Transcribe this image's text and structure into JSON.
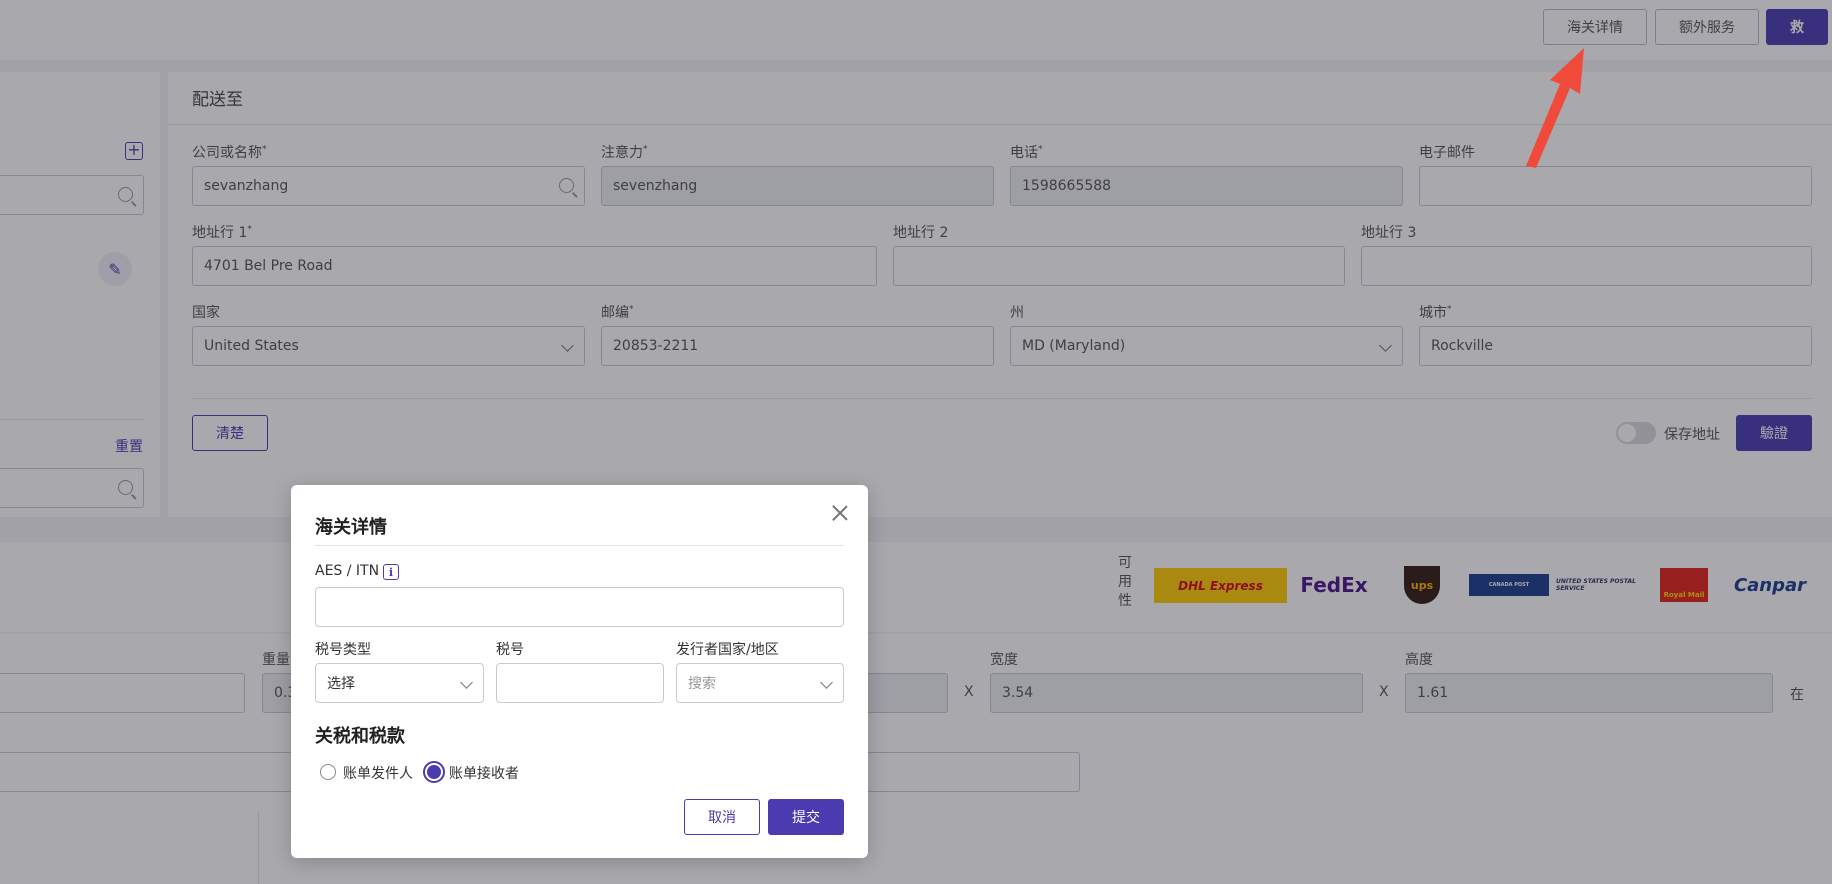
{
  "topbar": {
    "customs_label": "海关详情",
    "extra_services_label": "额外服务",
    "rescue_label": "救"
  },
  "ship_to": {
    "title": "配送至",
    "company_label": "公司或名称",
    "company_value": "sevanzhang",
    "attention_label": "注意力",
    "attention_value": "sevenzhang",
    "phone_label": "电话",
    "phone_value": "1598665588",
    "email_label": "电子邮件",
    "email_value": "",
    "address1_label": "地址行 1",
    "address1_value": "4701 Bel Pre Road",
    "address2_label": "地址行 2",
    "address2_value": "",
    "address3_label": "地址行 3",
    "address3_value": "",
    "country_label": "国家",
    "country_value": "United States",
    "zip_label": "邮编",
    "zip_value": "20853-2211",
    "state_label": "州",
    "state_value": "MD (Maryland)",
    "city_label": "城市",
    "city_value": "Rockville",
    "clear_label": "清楚",
    "save_address_label": "保存地址",
    "verify_label": "驗證",
    "required_mark": "*"
  },
  "left_panel": {
    "reset_label": "重置"
  },
  "availability": {
    "label_chars": [
      "可",
      "用",
      "性"
    ],
    "carriers": [
      "DHL Express",
      "FedEx",
      "ups",
      "CANADA POST",
      "UNITED STATES POSTAL SERVICE",
      "Royal Mail",
      "Canpar"
    ]
  },
  "dimensions": {
    "weight_label": "重量",
    "weight_value": "0.3",
    "width_label": "宽度",
    "width_value": "3.54",
    "height_label": "高度",
    "height_value": "1.61",
    "x_symbol": "X",
    "unit_label": "在"
  },
  "modal": {
    "title": "海关详情",
    "aes_label": "AES / ITN",
    "aes_value": "",
    "tax_type_label": "税号类型",
    "tax_type_value": "选择",
    "tax_no_label": "税号",
    "tax_no_value": "",
    "issuer_label": "发行者国家/地区",
    "issuer_placeholder": "搜索",
    "duties_title": "关税和税款",
    "bill_sender_label": "账单发件人",
    "bill_receiver_label": "账单接收者",
    "selected_bill_to": "账单接收者",
    "cancel_label": "取消",
    "submit_label": "提交"
  },
  "colors": {
    "accent": "#4a3cb0",
    "annotation_arrow": "#f04a3a"
  }
}
